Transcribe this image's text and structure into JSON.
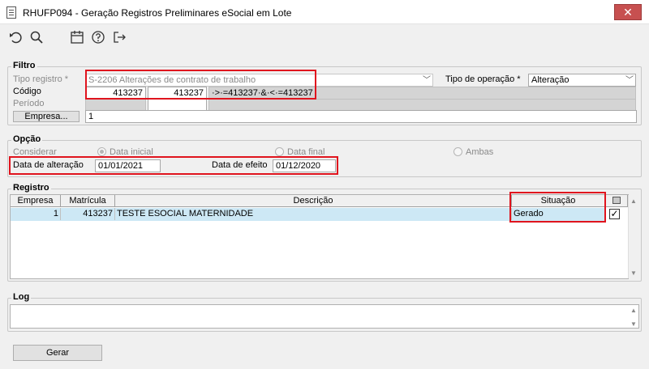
{
  "window": {
    "title": "RHUFP094 - Geração Registros Preliminares eSocial em Lote",
    "close_glyph": "✕"
  },
  "toolbar": {
    "icons": [
      "undo-icon",
      "search-icon",
      "calendar-icon",
      "help-icon",
      "exit-icon"
    ]
  },
  "filtro": {
    "title": "Filtro",
    "tipo_registro_label": "Tipo registro *",
    "tipo_registro_value": "S-2206 Alterações de contrato de trabalho",
    "tipo_operacao_label": "Tipo de operação *",
    "tipo_operacao_value": "Alteração",
    "codigo_label": "Código",
    "codigo_from": "413237",
    "codigo_to": "413237",
    "codigo_expr": "·>·=413237·&·<·=413237",
    "periodo_label": "Período",
    "empresa_button": "Empresa...",
    "empresa_value": "1"
  },
  "opcao": {
    "title": "Opção",
    "considerar_label": "Considerar",
    "options": [
      "Data inicial",
      "Data final",
      "Ambas"
    ],
    "selected": "Data inicial",
    "data_alteracao_label": "Data de alteração",
    "data_alteracao_value": "01/01/2021",
    "data_efeito_label": "Data de efeito",
    "data_efeito_value": "01/12/2020"
  },
  "registro": {
    "title": "Registro",
    "columns": [
      "Empresa",
      "Matrícula",
      "Descrição",
      "Situação"
    ],
    "rows": [
      {
        "empresa": "1",
        "matricula": "413237",
        "descricao": "TESTE ESOCIAL MATERNIDADE",
        "situacao": "Gerado",
        "checked": true
      }
    ]
  },
  "log": {
    "title": "Log",
    "value": ""
  },
  "actions": {
    "gerar_label": "Gerar"
  },
  "colors": {
    "highlight_red": "#e0141e",
    "row_selected": "#cde8f5",
    "close_button": "#c75050"
  }
}
